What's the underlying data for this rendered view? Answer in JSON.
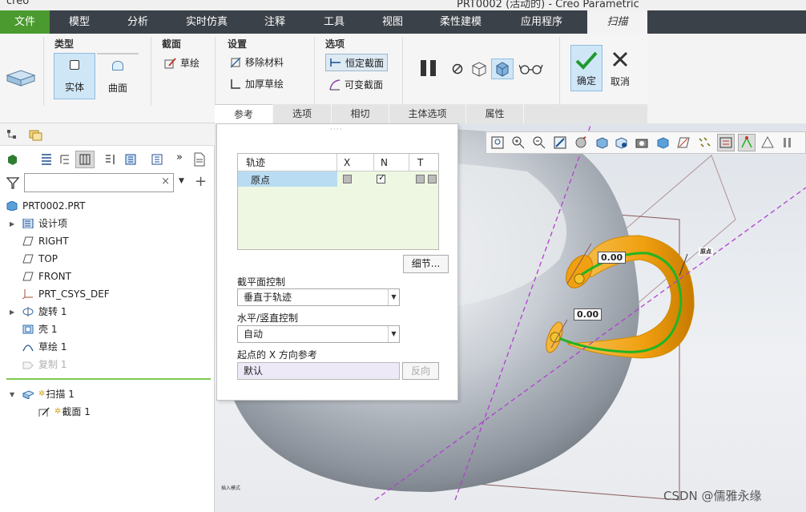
{
  "title_bar": {
    "app_glyph": "creo",
    "title": "PRT0002 (活动的) - Creo Parametric"
  },
  "menu": {
    "file": "文件",
    "items": [
      "模型",
      "分析",
      "实时仿真",
      "注释",
      "工具",
      "视图",
      "柔性建模",
      "应用程序"
    ],
    "active": "扫描"
  },
  "ribbon": {
    "type_group": {
      "title": "类型",
      "solid": "实体",
      "surface": "曲面"
    },
    "section_group": {
      "title": "截面",
      "sketch": "草绘"
    },
    "settings_group": {
      "title": "设置",
      "remove_material": "移除材料",
      "thicken_sketch": "加厚草绘"
    },
    "options_group": {
      "title": "选项",
      "constant_section": "恒定截面",
      "variable_section": "可变截面"
    },
    "confirm": "确定",
    "cancel": "取消"
  },
  "subtabs": [
    "参考",
    "选项",
    "相切",
    "主体选项",
    "属性"
  ],
  "panel": {
    "trajectory_table": {
      "headers": [
        "轨迹",
        "X",
        "N",
        "T"
      ],
      "rows": [
        {
          "name": "原点",
          "x": false,
          "n": true
        }
      ]
    },
    "details_button": "细节...",
    "section_plane_label": "截平面控制",
    "section_plane_value": "垂直于轨迹",
    "hv_control_label": "水平/竖直控制",
    "hv_control_value": "自动",
    "x_ref_label": "起点的 X 方向参考",
    "x_ref_value": "默认",
    "reverse_button": "反向"
  },
  "model_tree": {
    "search_placeholder": "",
    "items": [
      {
        "label": "PRT0002.PRT"
      },
      {
        "label": "设计项"
      },
      {
        "label": "RIGHT"
      },
      {
        "label": "TOP"
      },
      {
        "label": "FRONT"
      },
      {
        "label": "PRT_CSYS_DEF"
      },
      {
        "label": "旋转 1"
      },
      {
        "label": "壳 1"
      },
      {
        "label": "草绘 1"
      },
      {
        "label": "复制 1"
      },
      {
        "label": "扫描 1"
      },
      {
        "label": "截面 1"
      }
    ]
  },
  "viewport": {
    "dim1": "0.00",
    "dim2": "0.00",
    "origin_tag": "原点",
    "bottom_note": "插入模式"
  },
  "watermark": "CSDN @儒雅永缘",
  "colors": {
    "menubar": "#3b4148",
    "file_tab": "#4a9a2f",
    "sweep_orange": "#f0a010",
    "trajectory_green": "#22b422"
  }
}
